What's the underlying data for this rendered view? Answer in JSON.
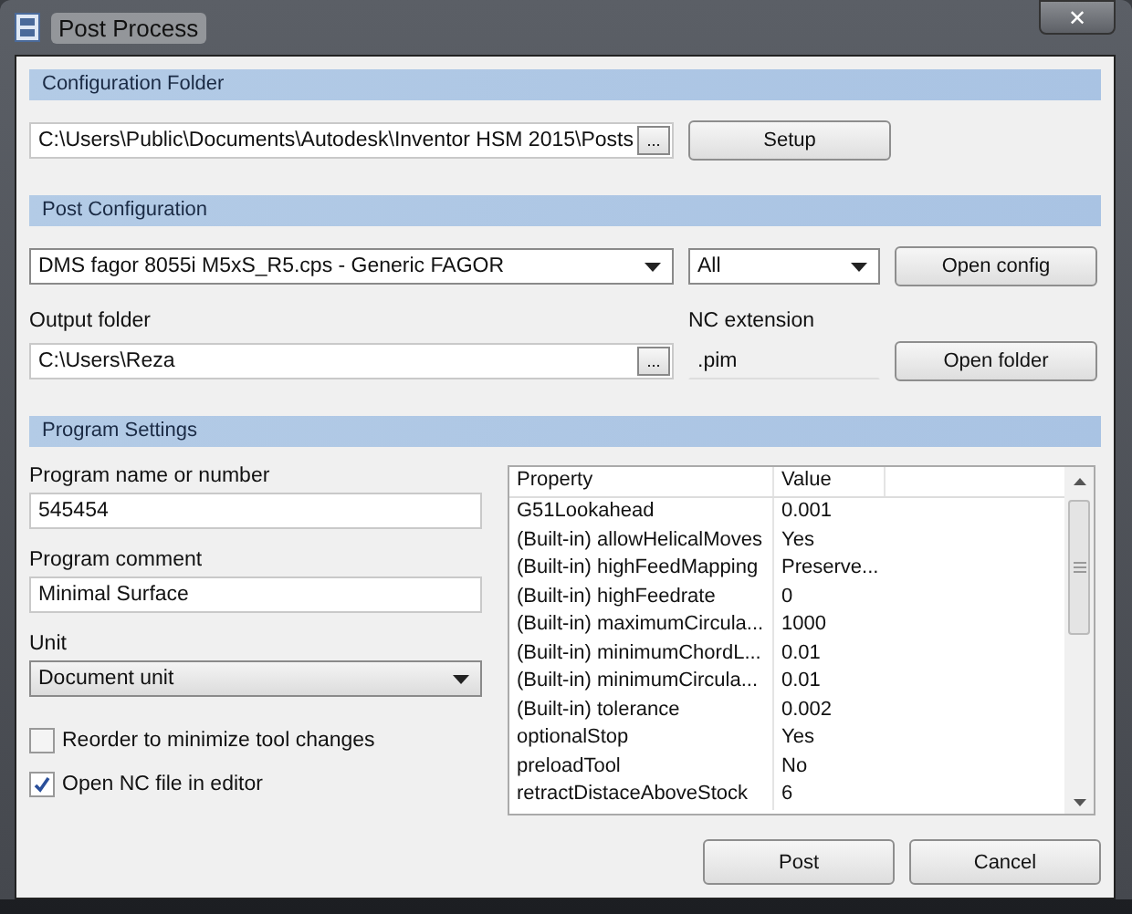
{
  "window": {
    "title": "Post Process",
    "close": "✕"
  },
  "configuration_folder": {
    "heading": "Configuration Folder",
    "path": "C:\\Users\\Public\\Documents\\Autodesk\\Inventor HSM 2015\\Posts",
    "browse": "...",
    "button": "Setup"
  },
  "post_configuration": {
    "heading": "Post Configuration",
    "post": "DMS fagor 8055i M5xS_R5.cps - Generic FAGOR",
    "filter": "All",
    "open_config": "Open config",
    "output_folder_label": "Output folder",
    "output_folder": "C:\\Users\\Reza",
    "browse": "...",
    "nc_extension_label": "NC extension",
    "nc_extension": ".pim",
    "open_folder": "Open folder"
  },
  "program_settings": {
    "heading": "Program Settings",
    "name_label": "Program name or number",
    "name": "545454",
    "comment_label": "Program comment",
    "comment": "Minimal Surface",
    "unit_label": "Unit",
    "unit": "Document unit",
    "options": [
      {
        "label": "Reorder to minimize tool changes",
        "checked": false
      },
      {
        "label": "Open NC file in editor",
        "checked": true
      }
    ]
  },
  "properties": {
    "columns": [
      "Property",
      "Value"
    ],
    "rows": [
      {
        "property": "G51Lookahead",
        "value": "0.001"
      },
      {
        "property": "(Built-in) allowHelicalMoves",
        "value": "Yes"
      },
      {
        "property": "(Built-in) highFeedMapping",
        "value": "Preserve..."
      },
      {
        "property": "(Built-in) highFeedrate",
        "value": "0"
      },
      {
        "property": "(Built-in) maximumCircula...",
        "value": "1000"
      },
      {
        "property": "(Built-in) minimumChordL...",
        "value": "0.01"
      },
      {
        "property": "(Built-in) minimumCircula...",
        "value": "0.01"
      },
      {
        "property": "(Built-in) tolerance",
        "value": "0.002"
      },
      {
        "property": "optionalStop",
        "value": "Yes"
      },
      {
        "property": "preloadTool",
        "value": "No"
      },
      {
        "property": "retractDistaceAboveStock",
        "value": "6"
      }
    ]
  },
  "buttons": [
    "Post",
    "Cancel"
  ]
}
